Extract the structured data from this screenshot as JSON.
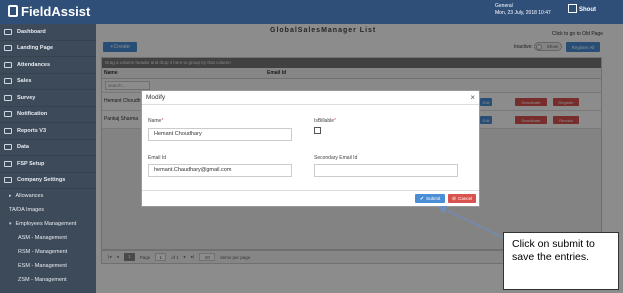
{
  "header": {
    "logo_text": "FieldAssist",
    "user_name": "General",
    "datetime": "Mon, 23 July, 2018 10:47",
    "shout_label": "Shout",
    "old_page_link": "Click to go to Old Page"
  },
  "sidebar": {
    "items": [
      {
        "label": "Dashboard",
        "icon": "dashboard-icon"
      },
      {
        "label": "Landing Page",
        "icon": "landing-page-icon"
      },
      {
        "label": "Attendances",
        "icon": "user-icon"
      },
      {
        "label": "Sales",
        "icon": "bar-chart-icon"
      },
      {
        "label": "Survey",
        "icon": "survey-icon"
      },
      {
        "label": "Notification",
        "icon": "bell-icon"
      },
      {
        "label": "Reports V3",
        "icon": "reports-icon"
      },
      {
        "label": "Data",
        "icon": "user-icon"
      },
      {
        "label": "FSP Setup",
        "icon": "user-icon"
      },
      {
        "label": "Company Settings",
        "icon": "gear-icon"
      }
    ],
    "sub_items": [
      {
        "label": "Allowances"
      },
      {
        "label": "TA/DA Images"
      },
      {
        "label": "Employees Management"
      }
    ],
    "subsub_items": [
      {
        "label": "ASM - Management"
      },
      {
        "label": "RSM - Management"
      },
      {
        "label": "ESM - Management"
      },
      {
        "label": "ZSM - Management"
      }
    ]
  },
  "main": {
    "title": "GlobalSalesManager List",
    "create_label": "+Create",
    "inactive_label": "Inactive:",
    "toggle_label": "Show",
    "register_all_label": "Register All",
    "group_hint": "Drag a column header and drop it here to group by that column",
    "columns": [
      "Name",
      "Email Id"
    ],
    "filter_placeholder": "search...",
    "rows": [
      {
        "name": "Hemant Choudh",
        "deactivate": "Deactivate",
        "register": "Register"
      },
      {
        "name": "Pankaj Sharma",
        "deactivate": "Deactivate",
        "register": "Revoke"
      }
    ],
    "edit_label": "Edit",
    "pager": {
      "page_label": "Page",
      "page_value": "1",
      "of_label": "of 1",
      "page_size": "20",
      "items_label": "items per page",
      "current_page": "1"
    }
  },
  "modal": {
    "title": "Modify",
    "name_label": "Name",
    "name_value": "Hemant Choudhary",
    "billable_label": "IsBillable",
    "email_label": "Email Id",
    "email_value": "hemant.Chaudhary@gmail.com",
    "secondary_email_label": "Secondary Email Id",
    "secondary_email_value": "",
    "submit_label": "Submit",
    "cancel_label": "Cancel",
    "required_mark": "*",
    "close_glyph": "×"
  },
  "callout": {
    "text": "Click on submit to save the entries."
  },
  "colors": {
    "header_bg": "#2f4f79",
    "sidebar_bg": "#3d4a5a",
    "primary": "#4a8fd6",
    "danger": "#d9534f"
  }
}
